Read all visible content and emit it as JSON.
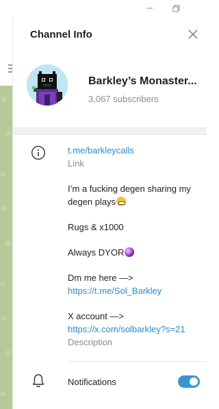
{
  "window": {
    "minimize_icon": "minimize-icon",
    "restore_icon": "restore-icon"
  },
  "panel": {
    "title": "Channel Info",
    "close_icon": "close-icon"
  },
  "channel": {
    "name": "Barkley’s Monaster...",
    "subscribers": "3,067 subscribers",
    "avatar": "pixel-art-avatar"
  },
  "info": {
    "icon": "info-icon",
    "link": "t.me/barkleycalls",
    "link_label": "Link",
    "description_lines": {
      "line1": "I’m a fucking degen sharing my",
      "line2": "degen plays",
      "line3": "Rugs & x1000",
      "line4": "Always DYOR",
      "line5": "Dm me here —>",
      "line6": "https://t.me/Sol_Barkley",
      "line7": "X account —>",
      "line8": "https://x.com/solbarkley?s=21"
    },
    "emojis": {
      "grimace": "grimacing-face-emoji",
      "crystal": "crystal-ball-emoji"
    },
    "description_label": "Description"
  },
  "notifications": {
    "icon": "bell-icon",
    "label": "Notifications",
    "enabled": true
  },
  "colors": {
    "accent": "#3a95d3",
    "link": "#2a8bd0",
    "muted": "#8b8b8b",
    "wallpaper": "#b7c99a"
  }
}
